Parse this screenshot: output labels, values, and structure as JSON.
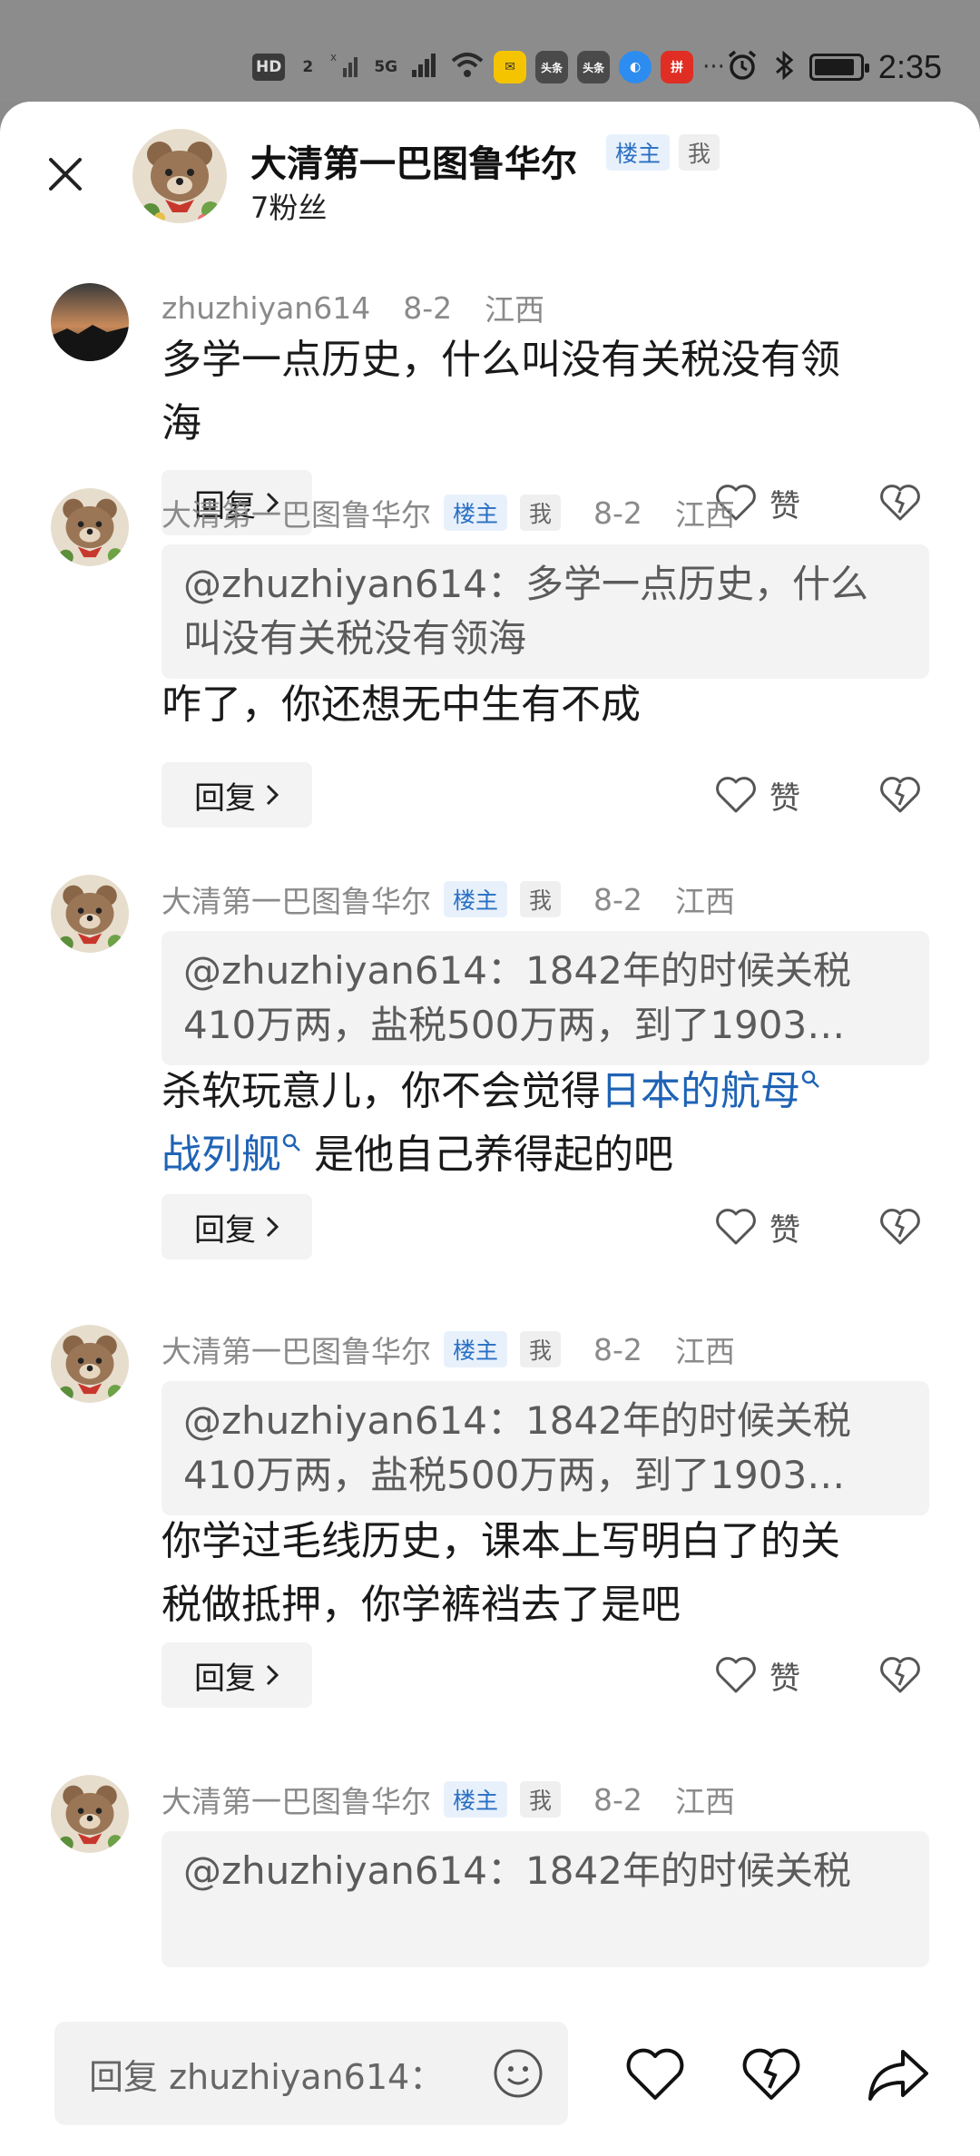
{
  "status_bar": {
    "network_labels": [
      "HD",
      "2",
      "5G"
    ],
    "app_icons": [
      {
        "name": "mail-icon",
        "color": "#f5c400",
        "glyph": "✉"
      },
      {
        "name": "toutiao-icon-1",
        "color": "#4a4a4a",
        "glyph": "头条"
      },
      {
        "name": "toutiao-icon-2",
        "color": "#4a4a4a",
        "glyph": "头条"
      },
      {
        "name": "browser-icon",
        "color": "#2d8cf0",
        "glyph": "◐"
      },
      {
        "name": "pinduoduo-icon",
        "color": "#e02e24",
        "glyph": "拼"
      }
    ],
    "more": "···",
    "time": "2:35",
    "battery_level": 0.9
  },
  "header": {
    "owner_name": "大清第一巴图鲁华尔",
    "host_badge": "楼主",
    "me_badge": "我",
    "fans": "7粉丝"
  },
  "comments": [
    {
      "author": "zhuzhiyan614",
      "date": "8-2",
      "location": "江西",
      "is_host": false,
      "text_lines": [
        "多学一点历史，什么叫没有关税没有领",
        "海"
      ],
      "reply_label": "回复",
      "like_label": "赞"
    },
    {
      "author": "大清第一巴图鲁华尔",
      "host_badge": "楼主",
      "me_badge": "我",
      "date": "8-2",
      "location": "江西",
      "is_host": true,
      "quote_lines": [
        "@zhuzhiyan614：多学一点历史，什么",
        "叫没有关税没有领海"
      ],
      "text_lines": [
        "咋了，你还想无中生有不成"
      ],
      "reply_label": "回复",
      "like_label": "赞"
    },
    {
      "author": "大清第一巴图鲁华尔",
      "host_badge": "楼主",
      "me_badge": "我",
      "date": "8-2",
      "location": "江西",
      "is_host": true,
      "quote_lines": [
        "@zhuzhiyan614：1842年的时候关税",
        "410万两，盐税500万两，到了1903…"
      ],
      "text_prefix": "杀软玩意儿，你不会觉得",
      "link_1": "日本的航母",
      "link_2": "战列舰",
      "text_suffix": "是他自己养得起的吧",
      "reply_label": "回复",
      "like_label": "赞"
    },
    {
      "author": "大清第一巴图鲁华尔",
      "host_badge": "楼主",
      "me_badge": "我",
      "date": "8-2",
      "location": "江西",
      "is_host": true,
      "quote_lines": [
        "@zhuzhiyan614：1842年的时候关税",
        "410万两，盐税500万两，到了1903…"
      ],
      "text_lines": [
        "你学过毛线历史，课本上写明白了的关",
        "税做抵押，你学裤裆去了是吧"
      ],
      "reply_label": "回复",
      "like_label": "赞"
    },
    {
      "author": "大清第一巴图鲁华尔",
      "host_badge": "楼主",
      "me_badge": "我",
      "date": "8-2",
      "location": "江西",
      "is_host": true,
      "quote_lines": [
        "@zhuzhiyan614：1842年的时候关税"
      ]
    }
  ],
  "bottom_bar": {
    "reply_placeholder": "回复 zhuzhiyan614："
  }
}
